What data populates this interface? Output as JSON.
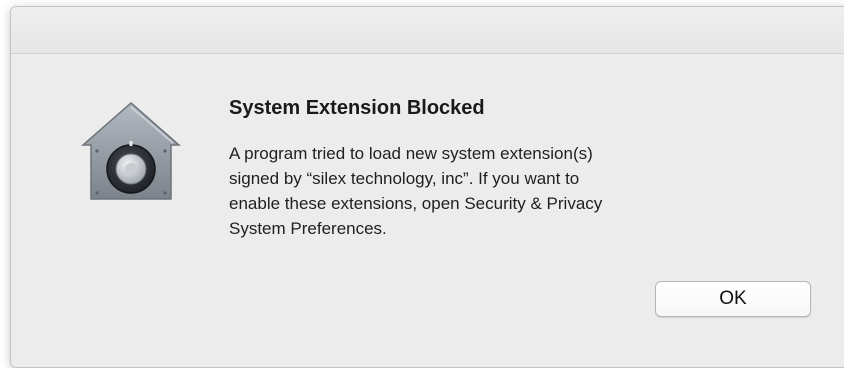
{
  "dialog": {
    "title": "System Extension Blocked",
    "message_lines": [
      "A program tried to load new system extension(s)",
      "signed by “silex technology, inc”.  If you want to",
      "enable these extensions, open Security & Privacy",
      "System Preferences."
    ],
    "ok_label": "OK",
    "icon": "security-lock-house-icon"
  },
  "colors": {
    "window_background": "#ececec",
    "titlebar": "#e8e8e8",
    "icon_body": "#8f959c",
    "icon_dial": "#2b2e33"
  }
}
